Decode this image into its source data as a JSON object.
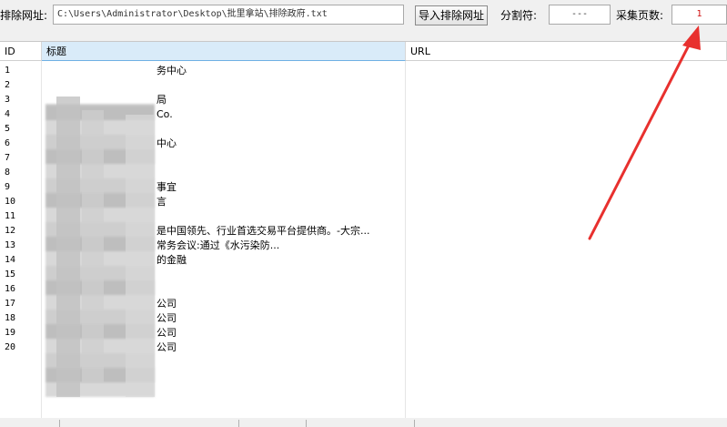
{
  "toolbar": {
    "exclude_label": "排除网址:",
    "exclude_path": "C:\\Users\\Administrator\\Desktop\\批里拿站\\排除政府.txt",
    "import_button": "导入排除网址",
    "separator_label": "分割符:",
    "separator_value": "---",
    "pages_label": "采集页数:",
    "pages_value": "1"
  },
  "table": {
    "columns": [
      "ID",
      "标题",
      "URL"
    ],
    "rows": [
      {
        "id": "1",
        "title": "务中心"
      },
      {
        "id": "2",
        "title": ""
      },
      {
        "id": "3",
        "title": "局"
      },
      {
        "id": "4",
        "title": "Co."
      },
      {
        "id": "5",
        "title": ""
      },
      {
        "id": "6",
        "title": "中心"
      },
      {
        "id": "7",
        "title": ""
      },
      {
        "id": "8",
        "title": ""
      },
      {
        "id": "9",
        "title": "事宜"
      },
      {
        "id": "10",
        "title": "言"
      },
      {
        "id": "11",
        "title": ""
      },
      {
        "id": "12",
        "title": "是中国领先、行业首选交易平台提供商。-大宗..."
      },
      {
        "id": "13",
        "title": "常务会议:通过《水污染防..."
      },
      {
        "id": "14",
        "title": "的金融"
      },
      {
        "id": "15",
        "title": ""
      },
      {
        "id": "16",
        "title": ""
      },
      {
        "id": "17",
        "title": "公司"
      },
      {
        "id": "18",
        "title": "公司"
      },
      {
        "id": "19",
        "title": "公司"
      },
      {
        "id": "20",
        "title": "公司"
      }
    ]
  },
  "colors": {
    "selected_header": "#d9ebf9",
    "arrow": "#e8302e"
  }
}
